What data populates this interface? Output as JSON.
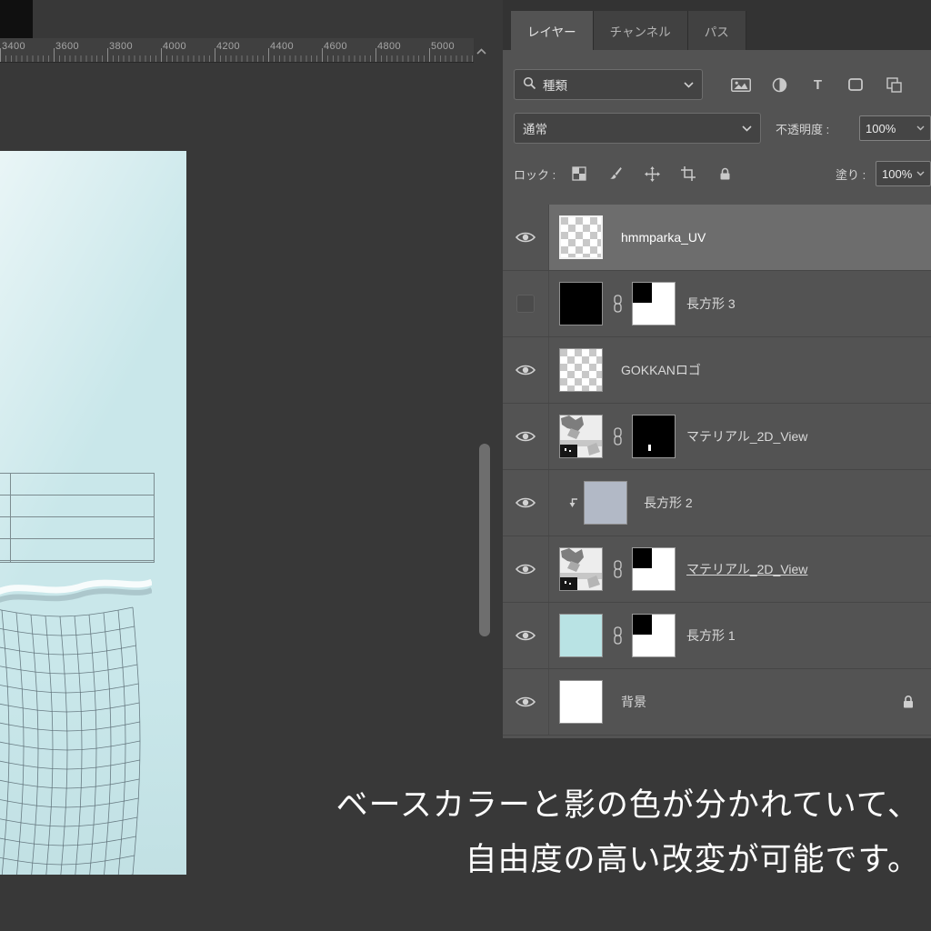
{
  "ruler": {
    "labels": [
      "3400",
      "3600",
      "3800",
      "4000",
      "4200",
      "4400",
      "4600",
      "4800",
      "5000"
    ]
  },
  "panel": {
    "tabs": [
      {
        "label": "レイヤー",
        "active": true
      },
      {
        "label": "チャンネル",
        "active": false
      },
      {
        "label": "パス",
        "active": false
      }
    ],
    "filter_row": {
      "search_label": "種類"
    },
    "blend_row": {
      "blend_mode": "通常",
      "opacity_label": "不透明度 :",
      "opacity_value": "100%"
    },
    "lock_row": {
      "lock_label": "ロック :",
      "fill_label": "塗り :",
      "fill_value": "100%"
    },
    "layers": [
      {
        "name": "hmmparka_UV",
        "visible": true,
        "selected": true,
        "thumb": "transparent-checker"
      },
      {
        "name": "長方形 3",
        "visible": false,
        "thumb": "black",
        "mask": "white-with-black-corner",
        "linked": true
      },
      {
        "name": "GOKKANロゴ",
        "visible": true,
        "thumb": "transparent-checker"
      },
      {
        "name": "マテリアル_2D_View",
        "visible": true,
        "thumb": "photo",
        "mask": "black-with-white-dot",
        "linked": true
      },
      {
        "name": "長方形 2",
        "visible": true,
        "thumb": "bluegray",
        "clipped": true
      },
      {
        "name": "マテリアル_2D_View",
        "visible": true,
        "thumb": "photo",
        "mask": "white-with-black-corner",
        "linked": true,
        "underlined": true
      },
      {
        "name": "長方形 1",
        "visible": true,
        "thumb": "cyan",
        "mask": "white-with-black-corner",
        "linked": true
      },
      {
        "name": "背景",
        "visible": true,
        "thumb": "white",
        "locked": true
      }
    ]
  },
  "caption": {
    "line1": "ベースカラーと影の色が分かれていて、",
    "line2": "自由度の高い改変が可能です。"
  },
  "colors": {
    "panel_bg": "#535353",
    "canvas_bg": "#383838",
    "document_cyan": "#c9e7ea",
    "selected_row": "#6d6d6d",
    "rect2_fill": "#b2b9c6",
    "rect1_fill": "#b9e3e4"
  }
}
